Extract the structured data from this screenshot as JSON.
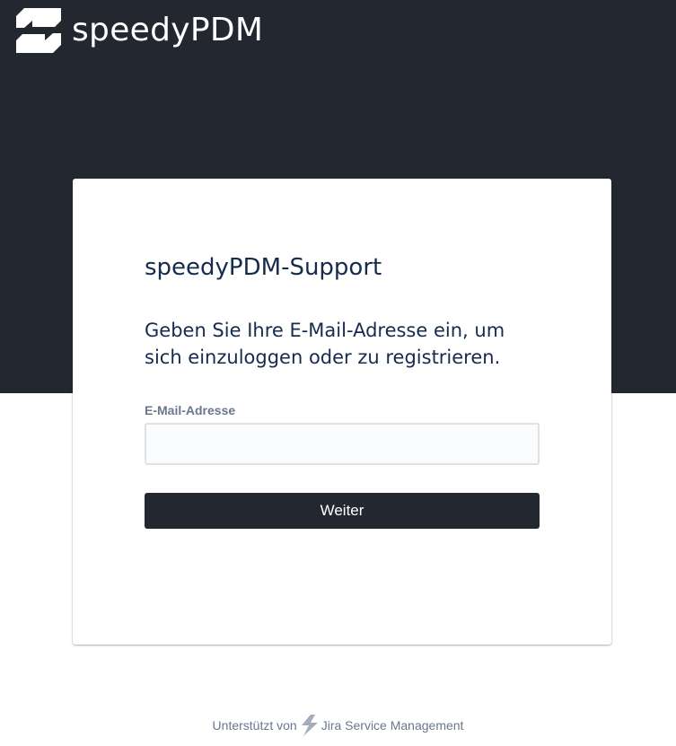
{
  "header": {
    "brand_name": "speedyPDM",
    "logo_icon": "speedypdm-logo-icon"
  },
  "card": {
    "title": "speedyPDM-Support",
    "instruction": "Geben Sie Ihre E-Mail-Adresse ein, um sich einzuloggen oder zu registrieren.",
    "email_label": "E-Mail-Adresse",
    "email_value": "",
    "email_placeholder": "",
    "continue_label": "Weiter"
  },
  "footer": {
    "powered_by": "Unterstützt von",
    "product_icon": "jira-service-management-bolt-icon",
    "product_name": "Jira Service Management"
  },
  "colors": {
    "header_bg": "#23272f",
    "button_bg": "#23272f",
    "text_primary": "#172b4d",
    "text_muted": "#6b778c"
  }
}
